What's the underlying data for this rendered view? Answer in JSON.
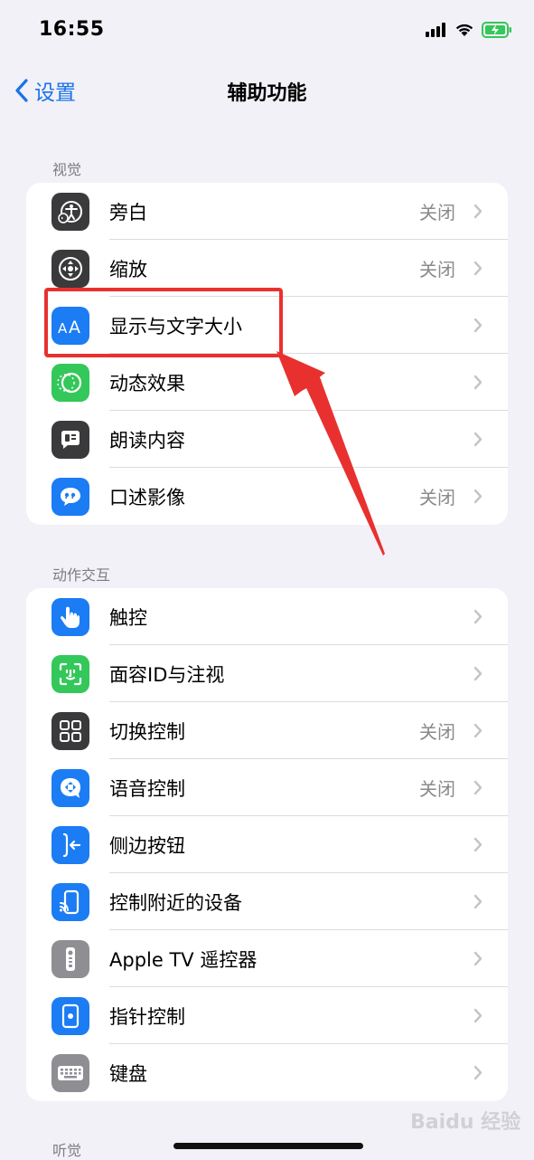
{
  "status_bar": {
    "time": "16:55"
  },
  "nav": {
    "back_label": "设置",
    "title": "辅助功能"
  },
  "sections": [
    {
      "header": "视觉",
      "items": [
        {
          "label": "旁白",
          "value": "关闭",
          "icon": "voiceover-icon",
          "color": "#3a3a3c"
        },
        {
          "label": "缩放",
          "value": "关闭",
          "icon": "zoom-icon",
          "color": "#3a3a3c"
        },
        {
          "label": "显示与文字大小",
          "value": "",
          "icon": "text-size-icon",
          "color": "#1b7cf3"
        },
        {
          "label": "动态效果",
          "value": "",
          "icon": "motion-icon",
          "color": "#34c759"
        },
        {
          "label": "朗读内容",
          "value": "",
          "icon": "spoken-content-icon",
          "color": "#3a3a3c"
        },
        {
          "label": "口述影像",
          "value": "关闭",
          "icon": "audio-description-icon",
          "color": "#1b7cf3"
        }
      ]
    },
    {
      "header": "动作交互",
      "items": [
        {
          "label": "触控",
          "value": "",
          "icon": "touch-icon",
          "color": "#1b7cf3"
        },
        {
          "label": "面容ID与注视",
          "value": "",
          "icon": "face-id-icon",
          "color": "#34c759"
        },
        {
          "label": "切换控制",
          "value": "关闭",
          "icon": "switch-control-icon",
          "color": "#3a3a3c"
        },
        {
          "label": "语音控制",
          "value": "关闭",
          "icon": "voice-control-icon",
          "color": "#1b7cf3"
        },
        {
          "label": "侧边按钮",
          "value": "",
          "icon": "side-button-icon",
          "color": "#1b7cf3"
        },
        {
          "label": "控制附近的设备",
          "value": "",
          "icon": "nearby-devices-icon",
          "color": "#1b7cf3"
        },
        {
          "label": "Apple TV 遥控器",
          "value": "",
          "icon": "apple-tv-remote-icon",
          "color": "#8e8e93"
        },
        {
          "label": "指针控制",
          "value": "",
          "icon": "pointer-control-icon",
          "color": "#1b7cf3"
        },
        {
          "label": "键盘",
          "value": "",
          "icon": "keyboard-icon",
          "color": "#8e8e93"
        }
      ]
    },
    {
      "header": "听觉",
      "items": []
    }
  ],
  "watermark": "Baidu 经验"
}
